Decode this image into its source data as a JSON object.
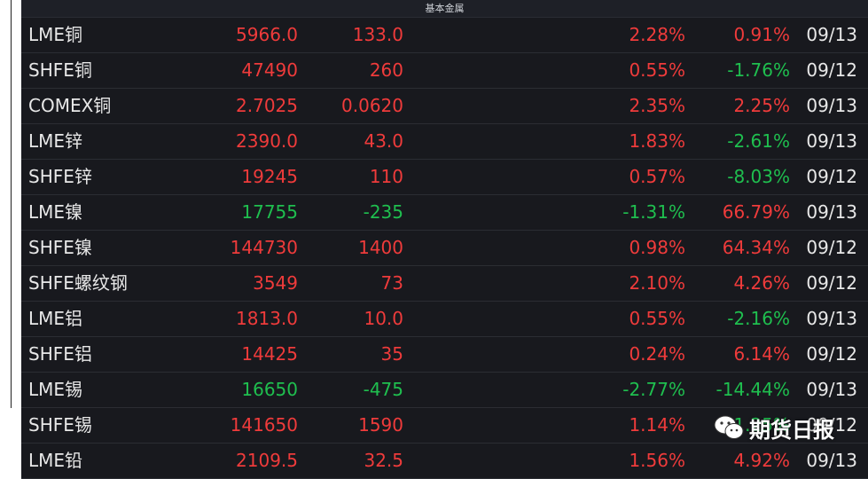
{
  "header": {
    "title": "基本金属"
  },
  "colors": {
    "up": "#ef3b3b",
    "down": "#1fbf4f",
    "background": "#18191e"
  },
  "rows": [
    {
      "name": "LME铜",
      "price": "5966.0",
      "change": "133.0",
      "pct1": "2.28%",
      "pct2": "0.91%",
      "date": "09/13",
      "price_dir": "up",
      "change_dir": "up",
      "pct1_dir": "up",
      "pct2_dir": "up"
    },
    {
      "name": "SHFE铜",
      "price": "47490",
      "change": "260",
      "pct1": "0.55%",
      "pct2": "-1.76%",
      "date": "09/12",
      "price_dir": "up",
      "change_dir": "up",
      "pct1_dir": "up",
      "pct2_dir": "down"
    },
    {
      "name": "COMEX铜",
      "price": "2.7025",
      "change": "0.0620",
      "pct1": "2.35%",
      "pct2": "2.25%",
      "date": "09/13",
      "price_dir": "up",
      "change_dir": "up",
      "pct1_dir": "up",
      "pct2_dir": "up"
    },
    {
      "name": "LME锌",
      "price": "2390.0",
      "change": "43.0",
      "pct1": "1.83%",
      "pct2": "-2.61%",
      "date": "09/13",
      "price_dir": "up",
      "change_dir": "up",
      "pct1_dir": "up",
      "pct2_dir": "down"
    },
    {
      "name": "SHFE锌",
      "price": "19245",
      "change": "110",
      "pct1": "0.57%",
      "pct2": "-8.03%",
      "date": "09/12",
      "price_dir": "up",
      "change_dir": "up",
      "pct1_dir": "up",
      "pct2_dir": "down"
    },
    {
      "name": "LME镍",
      "price": "17755",
      "change": "-235",
      "pct1": "-1.31%",
      "pct2": "66.79%",
      "date": "09/13",
      "price_dir": "down",
      "change_dir": "down",
      "pct1_dir": "down",
      "pct2_dir": "up"
    },
    {
      "name": "SHFE镍",
      "price": "144730",
      "change": "1400",
      "pct1": "0.98%",
      "pct2": "64.34%",
      "date": "09/12",
      "price_dir": "up",
      "change_dir": "up",
      "pct1_dir": "up",
      "pct2_dir": "up"
    },
    {
      "name": "SHFE螺纹钢",
      "price": "3549",
      "change": "73",
      "pct1": "2.10%",
      "pct2": "4.26%",
      "date": "09/12",
      "price_dir": "up",
      "change_dir": "up",
      "pct1_dir": "up",
      "pct2_dir": "up"
    },
    {
      "name": "LME铝",
      "price": "1813.0",
      "change": "10.0",
      "pct1": "0.55%",
      "pct2": "-2.16%",
      "date": "09/13",
      "price_dir": "up",
      "change_dir": "up",
      "pct1_dir": "up",
      "pct2_dir": "down"
    },
    {
      "name": "SHFE铝",
      "price": "14425",
      "change": "35",
      "pct1": "0.24%",
      "pct2": "6.14%",
      "date": "09/12",
      "price_dir": "up",
      "change_dir": "up",
      "pct1_dir": "up",
      "pct2_dir": "up"
    },
    {
      "name": "LME锡",
      "price": "16650",
      "change": "-475",
      "pct1": "-2.77%",
      "pct2": "-14.44%",
      "date": "09/13",
      "price_dir": "down",
      "change_dir": "down",
      "pct1_dir": "down",
      "pct2_dir": "down"
    },
    {
      "name": "SHFE锡",
      "price": "141650",
      "change": "1590",
      "pct1": "1.14%",
      "pct2": "1.25%",
      "date": "09/12",
      "price_dir": "up",
      "change_dir": "up",
      "pct1_dir": "up",
      "pct2_dir": "down"
    },
    {
      "name": "LME铅",
      "price": "2109.5",
      "change": "32.5",
      "pct1": "1.56%",
      "pct2": "4.92%",
      "date": "09/13",
      "price_dir": "up",
      "change_dir": "up",
      "pct1_dir": "up",
      "pct2_dir": "up"
    }
  ],
  "watermark": {
    "text": "期货日报",
    "icon": "wechat-icon"
  }
}
